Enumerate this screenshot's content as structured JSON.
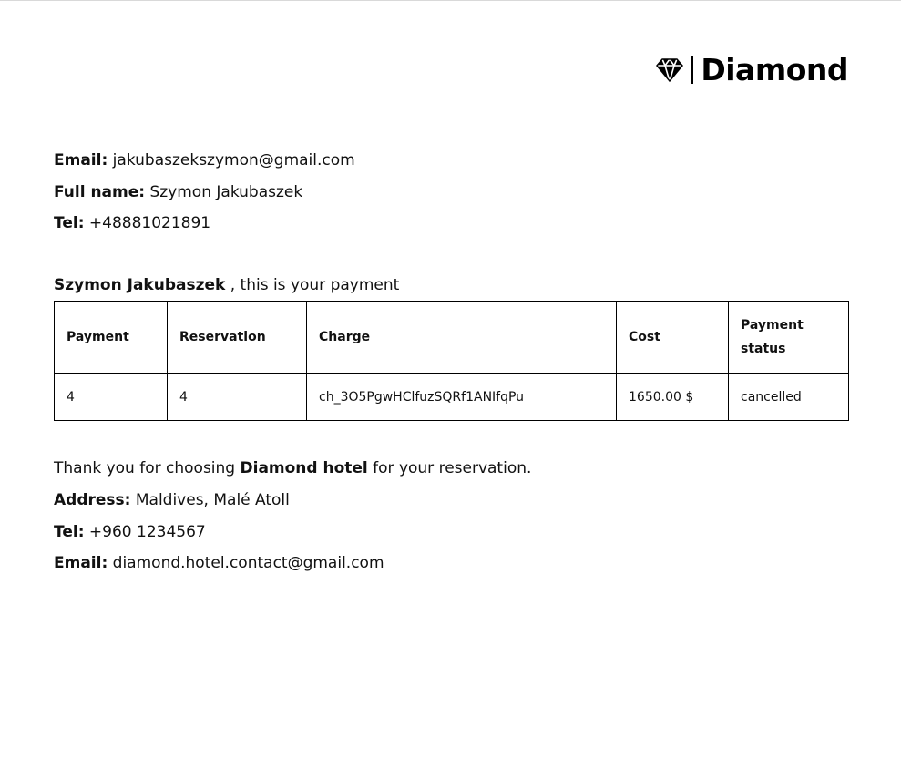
{
  "brand": {
    "name": "Diamond",
    "icon": "diamond-icon"
  },
  "customer": {
    "email_label": "Email:",
    "email": "jakubaszekszymon@gmail.com",
    "fullname_label": "Full name:",
    "fullname": "Szymon Jakubaszek",
    "tel_label": "Tel:",
    "tel": "+48881021891"
  },
  "greeting": {
    "name": "Szymon Jakubaszek",
    "text": " , this is your payment"
  },
  "table": {
    "headers": [
      "Payment",
      "Reservation",
      "Charge",
      "Cost",
      "Payment status"
    ],
    "rows": [
      [
        "4",
        "4",
        "ch_3O5PgwHClfuzSQRf1ANIfqPu",
        "1650.00 $",
        "cancelled"
      ]
    ]
  },
  "hotel": {
    "thanks_prefix": "Thank you for choosing ",
    "hotel_name": "Diamond hotel",
    "thanks_suffix": " for your reservation.",
    "address_label": "Address:",
    "address": "Maldives, Malé Atoll",
    "tel_label": "Tel:",
    "tel": "+960 1234567",
    "email_label": "Email:",
    "email": "diamond.hotel.contact@gmail.com"
  }
}
